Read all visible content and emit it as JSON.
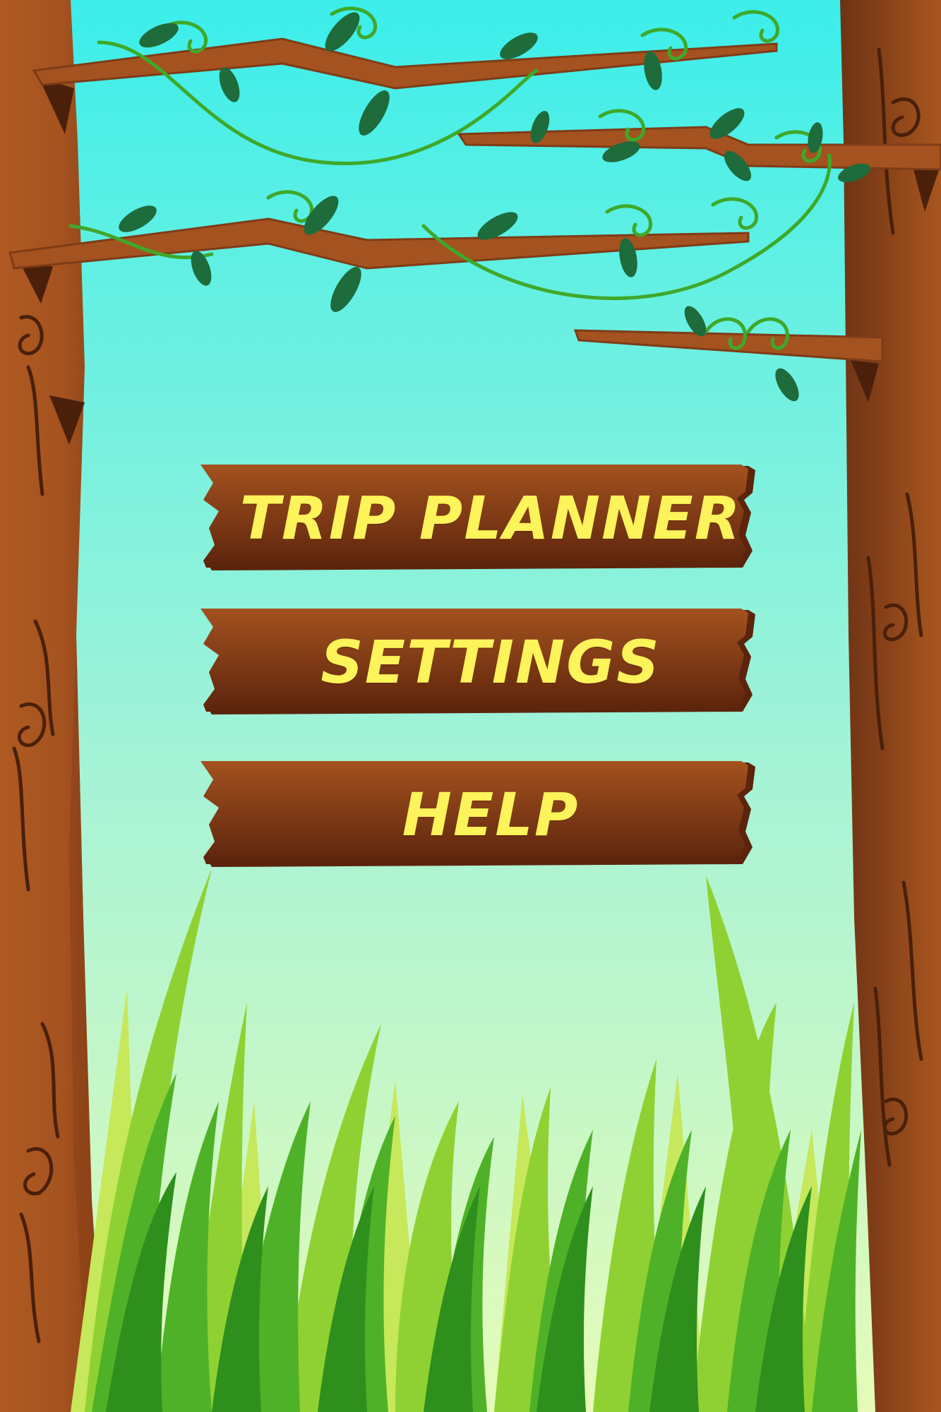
{
  "menu": {
    "trip_planner": "TRIP PLANNER",
    "settings": "SETTINGS",
    "help": "HELP"
  },
  "colors": {
    "sky_top": "#3ceeea",
    "sky_bottom": "#e6fbb8",
    "trunk": "#a4521f",
    "trunk_dark": "#6e3315",
    "plank": "#8c4318",
    "plank_dark": "#5c240c",
    "label_yellow": "#fdf35a",
    "grass_light": "#a8dd3c",
    "grass_dark": "#2e8f1c",
    "vine": "#3fa82a",
    "leaf": "#1e6b3c"
  }
}
